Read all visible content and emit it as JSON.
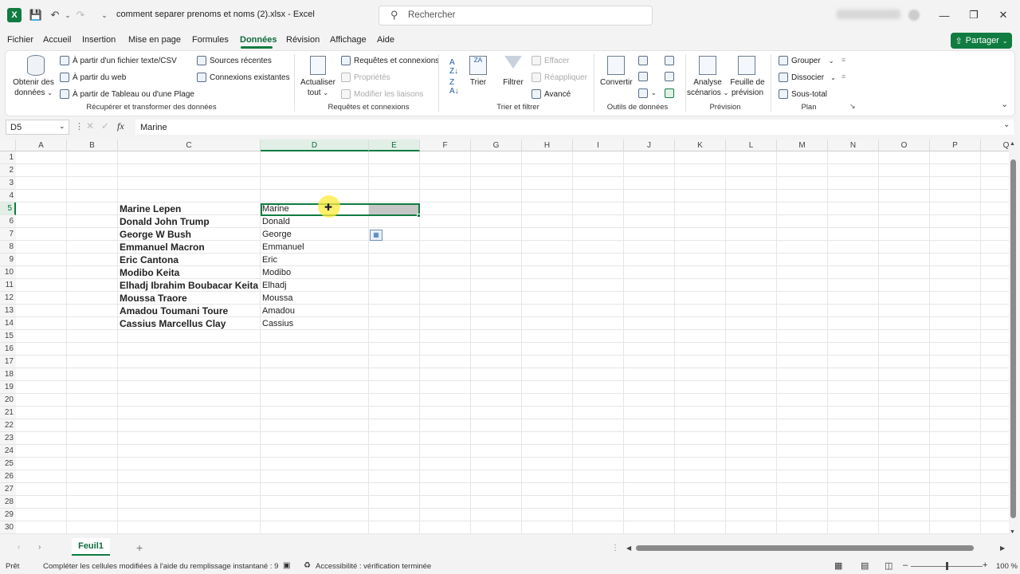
{
  "titlebar": {
    "title": "comment separer prenoms et noms (2).xlsx  -  Excel",
    "search_placeholder": "Rechercher",
    "app_icon": "excel-icon"
  },
  "menu": {
    "items": [
      "Fichier",
      "Accueil",
      "Insertion",
      "Mise en page",
      "Formules",
      "Données",
      "Révision",
      "Affichage",
      "Aide"
    ],
    "active": "Données",
    "share_label": "Partager"
  },
  "ribbon": {
    "get_data": {
      "obtenir": "Obtenir des",
      "donnees": "données",
      "from_text": "À partir d'un fichier texte/CSV",
      "from_web": "À partir du web",
      "from_table": "À partir de Tableau ou d'une Plage",
      "recent": "Sources récentes",
      "existing": "Connexions existantes",
      "label": "Récupérer et transformer des données"
    },
    "queries": {
      "refresh": "Actualiser",
      "refresh2": "tout",
      "queries_conn": "Requêtes et connexions",
      "properties": "Propriétés",
      "edit_links": "Modifier les liaisons",
      "label": "Requêtes et connexions"
    },
    "sort": {
      "sort": "Trier",
      "filter": "Filtrer",
      "clear": "Effacer",
      "reapply": "Réappliquer",
      "advanced": "Avancé",
      "label": "Trier et filtrer"
    },
    "tools": {
      "convert": "Convertir",
      "label": "Outils de données"
    },
    "forecast": {
      "whatif": "Analyse",
      "whatif2": "scénarios",
      "sheet": "Feuille de",
      "sheet2": "prévision",
      "label": "Prévision"
    },
    "outline": {
      "group": "Grouper",
      "ungroup": "Dissocier",
      "subtotal": "Sous-total",
      "label": "Plan"
    }
  },
  "formula_bar": {
    "name_box": "D5",
    "content": "Marine"
  },
  "grid": {
    "columns": [
      "A",
      "B",
      "C",
      "D",
      "E",
      "F",
      "G",
      "H",
      "I",
      "J",
      "K",
      "L",
      "M",
      "N",
      "O",
      "P",
      "Q"
    ],
    "selected_columns": [
      "D",
      "E"
    ],
    "rows": [
      "1",
      "2",
      "3",
      "4",
      "5",
      "6",
      "7",
      "8",
      "9",
      "10",
      "11",
      "12",
      "13",
      "14",
      "15",
      "16",
      "17",
      "18",
      "19",
      "20",
      "21",
      "22",
      "23",
      "24",
      "25",
      "26",
      "27",
      "28",
      "29",
      "30"
    ],
    "selected_row": "5",
    "full_names": [
      "Marine Lepen",
      "Donald John Trump",
      "George W Bush",
      "Emmanuel Macron",
      "Eric Cantona",
      "Modibo Keita",
      "Elhadj Ibrahim Boubacar Keita",
      "Moussa Traore",
      "Amadou Toumani Toure",
      "Cassius Marcellus Clay"
    ],
    "first_names": [
      "Marine",
      "Donald",
      "George",
      "Emmanuel",
      "Eric",
      "Modibo",
      "Elhadj",
      "Moussa",
      "Amadou",
      "Cassius"
    ]
  },
  "sheets": {
    "active": "Feuil1"
  },
  "status": {
    "ready": "Prêt",
    "message": "Compléter les cellules modifiées à l'aide du remplissage instantané : 9",
    "accessibility": "Accessibilité : vérification terminée",
    "zoom": "100 %"
  }
}
